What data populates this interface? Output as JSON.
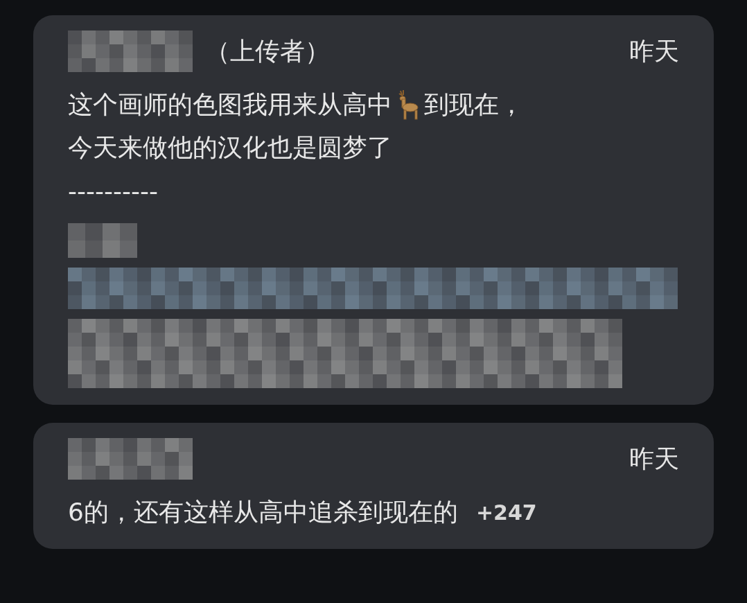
{
  "comments": [
    {
      "uploader_tag": "（上传者）",
      "time": "昨天",
      "lines": [
        {
          "parts": [
            {
              "kind": "text",
              "text": "这个画师的色图我用来从高中"
            },
            {
              "kind": "deer"
            },
            {
              "kind": "text",
              "text": "到现在，"
            }
          ]
        },
        {
          "parts": [
            {
              "kind": "text",
              "text": "今天来做他的汉化也是圆梦了"
            }
          ]
        },
        {
          "parts": [
            {
              "kind": "text",
              "text": "----------"
            }
          ]
        }
      ],
      "redactions": [
        {
          "kind": "short"
        },
        {
          "kind": "link"
        },
        {
          "kind": "paragraph"
        }
      ]
    },
    {
      "time": "昨天",
      "lines": [
        {
          "parts": [
            {
              "kind": "text",
              "text": "6的，还有这样从高中追杀到现在的"
            },
            {
              "kind": "count",
              "text": "+247"
            }
          ]
        }
      ]
    }
  ]
}
